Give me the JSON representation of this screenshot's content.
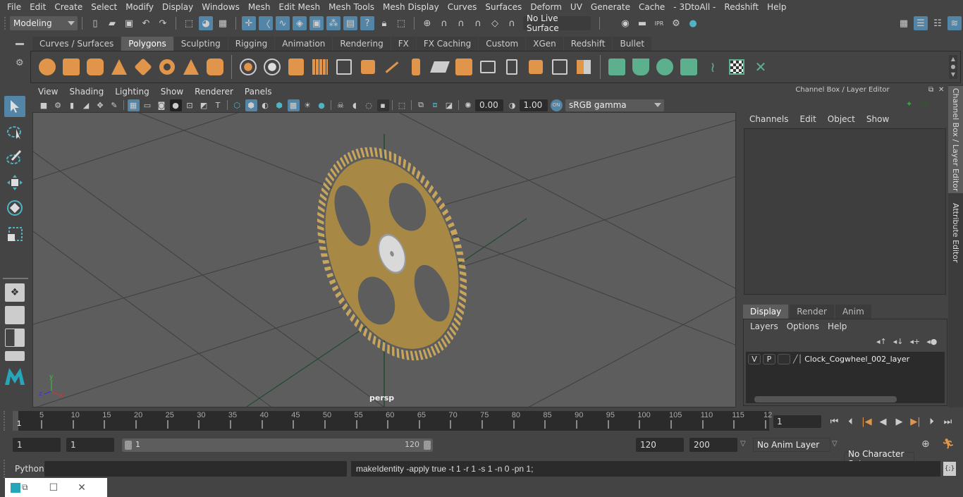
{
  "menubar": [
    "File",
    "Edit",
    "Create",
    "Select",
    "Modify",
    "Display",
    "Windows",
    "Mesh",
    "Edit Mesh",
    "Mesh Tools",
    "Mesh Display",
    "Curves",
    "Surfaces",
    "Deform",
    "UV",
    "Generate",
    "Cache",
    "- 3DtoAll -",
    "Redshift",
    "Help"
  ],
  "statusline": {
    "workspace": "Modeling",
    "live_surface": "No Live Surface"
  },
  "shelf": {
    "tabs": [
      "Curves / Surfaces",
      "Polygons",
      "Sculpting",
      "Rigging",
      "Animation",
      "Rendering",
      "FX",
      "FX Caching",
      "Custom",
      "XGen",
      "Redshift",
      "Bullet"
    ],
    "active_tab": "Polygons"
  },
  "viewport": {
    "menu": [
      "View",
      "Shading",
      "Lighting",
      "Show",
      "Renderer",
      "Panels"
    ],
    "exposure": "0.00",
    "gamma": "1.00",
    "color_space": "sRGB gamma",
    "color_mgmt_badge": "ON",
    "camera_label": "persp",
    "axis_labels": {
      "x": "x",
      "y": "y",
      "z": "z"
    }
  },
  "right_panel": {
    "title": "Channel Box / Layer Editor",
    "channel_menu": [
      "Channels",
      "Edit",
      "Object",
      "Show"
    ],
    "layer_tabs": [
      "Display",
      "Render",
      "Anim"
    ],
    "active_layer_tab": "Display",
    "layer_menu": [
      "Layers",
      "Options",
      "Help"
    ],
    "layers": [
      {
        "v": "V",
        "p": "P",
        "name": "Clock_Cogwheel_002_layer"
      }
    ],
    "side_tabs": [
      "Channel Box / Layer Editor",
      "Attribute Editor"
    ]
  },
  "timeline": {
    "ticks": [
      "5",
      "10",
      "15",
      "20",
      "25",
      "30",
      "35",
      "40",
      "45",
      "50",
      "55",
      "60",
      "65",
      "70",
      "75",
      "80",
      "85",
      "90",
      "95",
      "100",
      "105",
      "110",
      "115",
      "12"
    ],
    "start_marker": "1",
    "current_frame": "1"
  },
  "range": {
    "start": "1",
    "playback_start": "1",
    "range_min_label": "1",
    "range_max_label": "120",
    "playback_end": "120",
    "end": "200",
    "anim_layer": "No Anim Layer",
    "character_set": "No Character Set"
  },
  "cmdline": {
    "language": "Python",
    "input": "",
    "output": "makeIdentity -apply true -t 1 -r 1 -s 1 -n 0 -pn 1;"
  },
  "colors": {
    "accent": "#5285a6",
    "poly_icon": "#e0954b",
    "deform_icon": "#5db08d",
    "keyframe": "#e0954b"
  }
}
